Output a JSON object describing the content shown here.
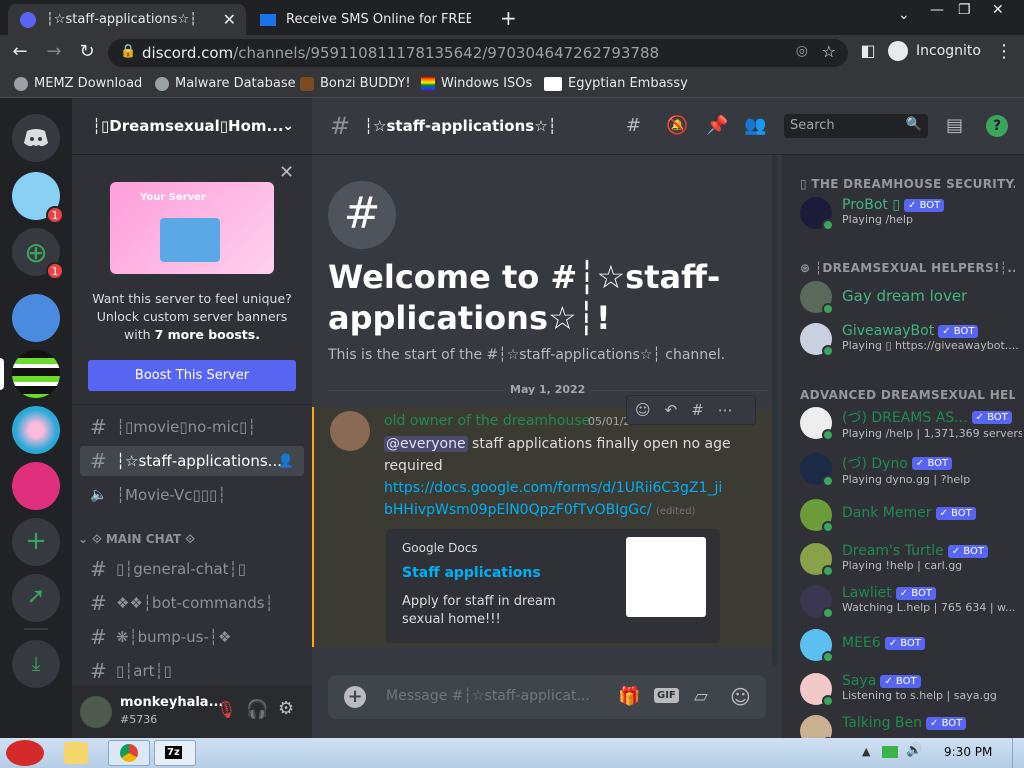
{
  "tabs": [
    {
      "title": "┆☆staff-applications☆┆"
    },
    {
      "title": "Receive SMS Online for FREE |"
    }
  ],
  "url": {
    "domain": "discord.com",
    "path": "/channels/959110811178135642/970304647262793788"
  },
  "incognito_label": "Incognito",
  "bookmarks": [
    "MEMZ Download",
    "Malware Database",
    "Bonzi BUDDY!",
    "Windows ISOs",
    "Egyptian Embassy"
  ],
  "server": {
    "name": "┆▯Dreamsexual▯Hom...",
    "promo_text": "Want this server to feel unique? Unlock custom server banners with",
    "promo_bold": "7 more boosts.",
    "promo_card_label": "Your Server",
    "boost_button": "Boost This Server"
  },
  "channels": [
    {
      "name": "┆▯movie▯no-mic▯┆",
      "icon": "#"
    },
    {
      "name": "┆☆staff-applications...",
      "icon": "#",
      "selected": true
    },
    {
      "name": "┆Movie-Vc▯▯▯┆",
      "icon": "speaker"
    }
  ],
  "category": "⟐ MAIN CHAT ⟐",
  "channels2": [
    {
      "name": "▯┆general-chat┆▯"
    },
    {
      "name": "❖❖┆bot-commands┆"
    },
    {
      "name": "❋┆bump-us-┆❖"
    },
    {
      "name": "▯┆art┆▯"
    }
  ],
  "user": {
    "name": "monkeyhala...",
    "tag": "#5736"
  },
  "topbar": {
    "channel": "┆☆staff-applications☆┆",
    "search_placeholder": "Search"
  },
  "welcome": {
    "title": "Welcome to #┆☆staff-applications☆┆!",
    "subtitle": "This is the start of the #┆☆staff-applications☆┆ channel."
  },
  "date_divider": "May 1, 2022",
  "message": {
    "author": "old owner of the dreamhouse",
    "timestamp": "05/01/2022",
    "mention": "@everyone",
    "text": " staff applications finally open no age required",
    "link": "https://docs.google.com/forms/d/1URii6C3gZ1_jibHHivpWsm09pElN0QpzF0fTvOBIgGc/",
    "edited": "(edited)"
  },
  "embed": {
    "provider": "Google Docs",
    "title": "Staff applications",
    "description": "Apply for staff in dream sexual home!!!"
  },
  "composer": {
    "placeholder": "Message #┆☆staff-applicat..."
  },
  "members": {
    "groups": [
      "▯ THE DREAMHOUSE SECURITY...",
      "⊛ ┆DREAMSEXUAL HELPERS!┆...",
      "ADVANCED DREAMSEXUAL HELP..."
    ],
    "list": [
      {
        "name": "ProBot ▯",
        "bot": "✓ BOT",
        "sub": "Playing /help",
        "color": "#43b581"
      },
      {
        "name": "Gay dream lover",
        "bot": "",
        "sub": "",
        "color": "#43b581"
      },
      {
        "name": "GiveawayBot",
        "bot": "✓ BOT",
        "sub": "Playing ▯ https://giveawaybot....",
        "color": "#43b581"
      },
      {
        "name": "(づ) DREAMS AS...",
        "bot": "✓ BOT",
        "sub": "Playing /help | 1,371,369 servers",
        "color": "#1f8b4c"
      },
      {
        "name": "(づ) Dyno",
        "bot": "✓ BOT",
        "sub": "Playing dyno.gg | ?help",
        "color": "#1f8b4c"
      },
      {
        "name": "Dank Memer",
        "bot": "✓ BOT",
        "sub": "",
        "color": "#1f8b4c"
      },
      {
        "name": "Dream's Turtle",
        "bot": "✓ BOT",
        "sub": "Playing !help | carl.gg",
        "color": "#1f8b4c"
      },
      {
        "name": "Lawliet",
        "bot": "✓ BOT",
        "sub": "Watching L.help | 765 634 | w...",
        "color": "#1f8b4c"
      },
      {
        "name": "MEE6",
        "bot": "✓ BOT",
        "sub": "",
        "color": "#1f8b4c"
      },
      {
        "name": "Saya",
        "bot": "✓ BOT",
        "sub": "Listening to s.help | saya.gg",
        "color": "#1f8b4c"
      },
      {
        "name": "Talking Ben",
        "bot": "✓ BOT",
        "sub": "",
        "color": "#1f8b4c"
      }
    ]
  },
  "badges": {
    "guild1": "1",
    "guild2": "1"
  },
  "clock": "9:30 PM"
}
